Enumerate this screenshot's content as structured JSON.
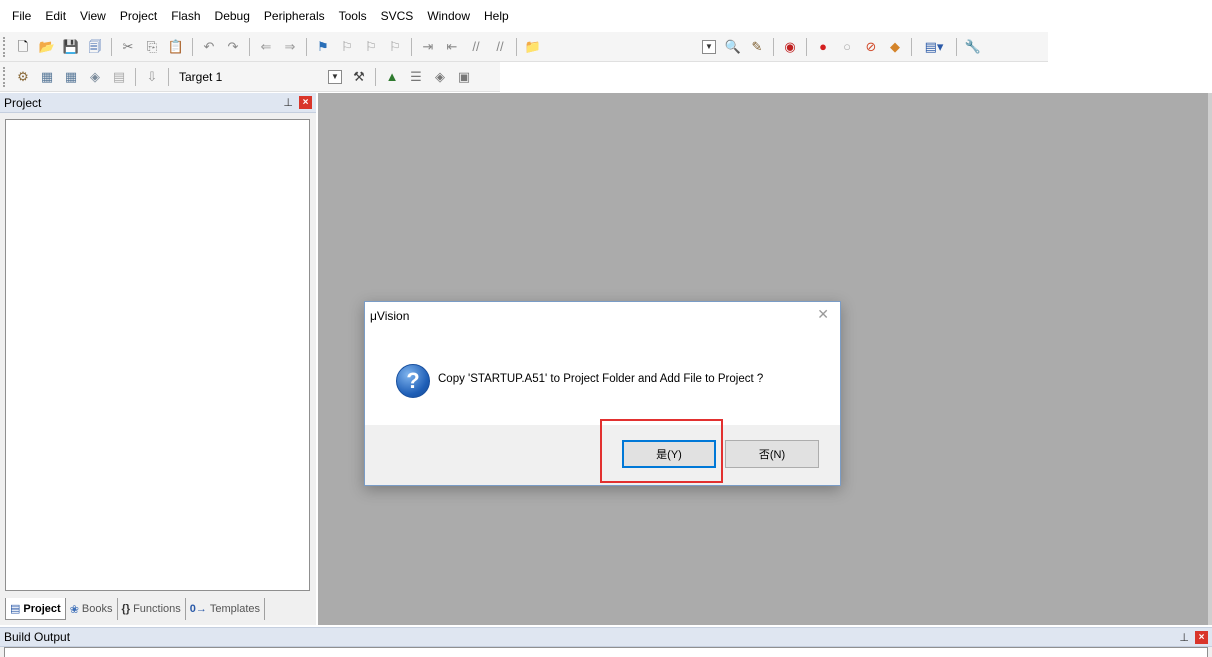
{
  "menu": [
    "File",
    "Edit",
    "View",
    "Project",
    "Flash",
    "Debug",
    "Peripherals",
    "Tools",
    "SVCS",
    "Window",
    "Help"
  ],
  "toolbar": {
    "target": "Target 1"
  },
  "project_panel": {
    "title": "Project",
    "tabs": [
      "Project",
      "Books",
      "Functions",
      "Templates"
    ],
    "tab_icons": [
      "{}",
      "0→"
    ]
  },
  "build_output": {
    "title": "Build Output"
  },
  "dialog": {
    "title": "μVision",
    "message": "Copy 'STARTUP.A51' to Project Folder and Add File to Project ?",
    "yes_label": "是(Y)",
    "no_label": "否(N)"
  },
  "colors": {
    "workspace": "#ababab",
    "panel_header": "#dfe6f1",
    "highlight": "#e2302f",
    "close_red": "#d9352a"
  }
}
